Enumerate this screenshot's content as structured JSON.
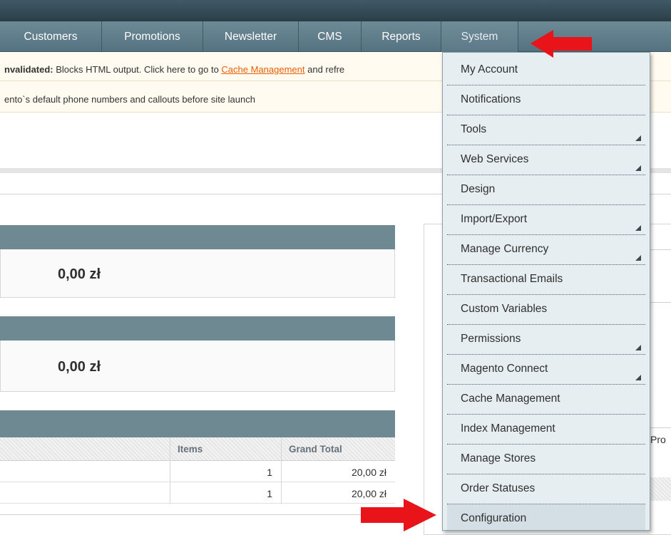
{
  "nav": {
    "items": [
      {
        "label": "Customers"
      },
      {
        "label": "Promotions"
      },
      {
        "label": "Newsletter"
      },
      {
        "label": "CMS"
      },
      {
        "label": "Reports"
      },
      {
        "label": "System"
      }
    ]
  },
  "messages": {
    "cache_prefix": "nvalidated:",
    "cache_text": " Blocks HTML output. Click here to go to ",
    "cache_link": "Cache Management",
    "cache_suffix": " and refre",
    "phone_text": "ento`s default phone numbers and callouts before site launch"
  },
  "dashboard": {
    "lifetime_sales": "0,00 zł",
    "average_orders": "0,00 zł",
    "grid_headers": {
      "items": "Items",
      "grand_total": "Grand Total"
    },
    "rows": [
      {
        "items": "1",
        "grand_total": "20,00 zł"
      },
      {
        "items": "1",
        "grand_total": "20,00 zł"
      }
    ],
    "right_tab_fragment": "Pro"
  },
  "system_menu": {
    "items": [
      {
        "label": "My Account",
        "has_sub": false
      },
      {
        "label": "Notifications",
        "has_sub": false
      },
      {
        "label": "Tools",
        "has_sub": true
      },
      {
        "label": "Web Services",
        "has_sub": true
      },
      {
        "label": "Design",
        "has_sub": false
      },
      {
        "label": "Import/Export",
        "has_sub": true
      },
      {
        "label": "Manage Currency",
        "has_sub": true
      },
      {
        "label": "Transactional Emails",
        "has_sub": false
      },
      {
        "label": "Custom Variables",
        "has_sub": false
      },
      {
        "label": "Permissions",
        "has_sub": true
      },
      {
        "label": "Magento Connect",
        "has_sub": true
      },
      {
        "label": "Cache Management",
        "has_sub": false
      },
      {
        "label": "Index Management",
        "has_sub": false
      },
      {
        "label": "Manage Stores",
        "has_sub": false
      },
      {
        "label": "Order Statuses",
        "has_sub": false
      },
      {
        "label": "Configuration",
        "has_sub": false
      }
    ]
  },
  "colors": {
    "nav_bg": "#6d8a97",
    "box_header": "#6f8992",
    "menu_bg": "#e7eef1",
    "link_orange": "#eb5e00",
    "arrow_red": "#e8141a"
  }
}
